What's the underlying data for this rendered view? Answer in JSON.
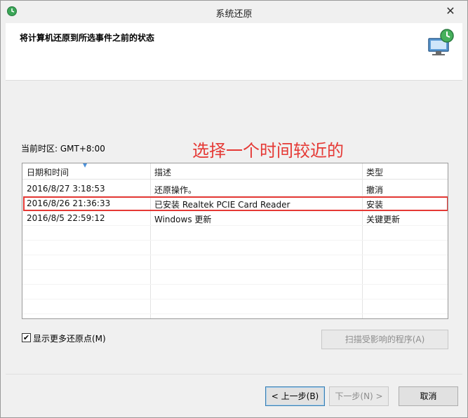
{
  "window": {
    "title": "系统还原",
    "close_glyph": "✕"
  },
  "header": {
    "heading": "将计算机还原到所选事件之前的状态"
  },
  "timezone": "当前时区: GMT+8:00",
  "annotation": "选择一个时间较近的",
  "table": {
    "columns": [
      "日期和时间",
      "描述",
      "类型"
    ],
    "rows": [
      {
        "date": "2016/8/27 3:18:53",
        "desc": "还原操作。",
        "type": "撤消"
      },
      {
        "date": "2016/8/26 21:36:33",
        "desc": "已安装 Realtek PCIE Card Reader",
        "type": "安装"
      },
      {
        "date": "2016/8/5 22:59:12",
        "desc": "Windows 更新",
        "type": "关键更新"
      }
    ],
    "highlight_row": 1
  },
  "show_more": {
    "label": "显示更多还原点(M)",
    "checked": true,
    "check_glyph": "✔"
  },
  "buttons": {
    "scan": "扫描受影响的程序(A)",
    "back": "< 上一步(B)",
    "next": "下一步(N) >",
    "cancel": "取消"
  },
  "icons": {
    "app": "system-restore-icon",
    "header": "computer-restore-icon",
    "close": "close-icon"
  },
  "colors": {
    "annotation": "#e53935",
    "highlight_border": "#e53935"
  }
}
